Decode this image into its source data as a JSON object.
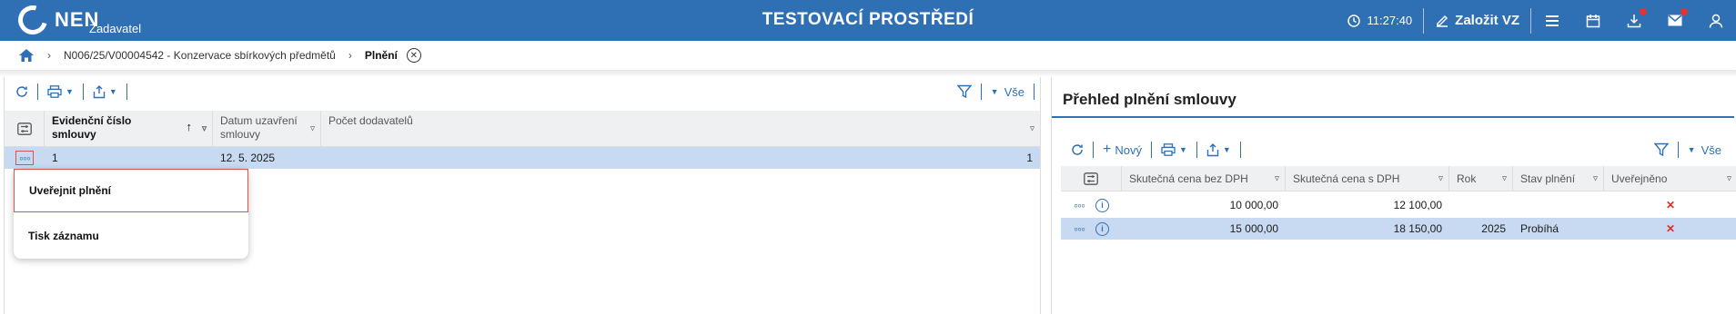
{
  "topbar": {
    "logo": "NEN",
    "role": "Zadavatel",
    "env_title": "TESTOVACÍ PROSTŘEDÍ",
    "time": "11:27:40",
    "create_label": "Založit VZ"
  },
  "breadcrumb": {
    "item1": "N006/25/V00004542 - Konzervace sbírkových předmětů",
    "current": "Plnění"
  },
  "left": {
    "filter_label": "Vše",
    "columns": [
      "Evidenční číslo smlouvy",
      "Datum uzavření smlouvy",
      "Počet dodavatelů"
    ],
    "rows": [
      {
        "c1": "1",
        "c2": "12. 5. 2025",
        "c3": "1"
      }
    ],
    "menu": [
      "Uveřejnit plnění",
      "Tisk záznamu"
    ]
  },
  "right": {
    "title": "Přehled plnění smlouvy",
    "new_label": "Nový",
    "filter_label": "Vše",
    "columns": [
      "Skutečná cena bez DPH",
      "Skutečná cena s DPH",
      "Rok",
      "Stav plnění",
      "Uveřejněno"
    ],
    "rows": [
      {
        "c1": "10 000,00",
        "c2": "12 100,00",
        "c3": "",
        "c4": "",
        "c5": "✕"
      },
      {
        "c1": "15 000,00",
        "c2": "18 150,00",
        "c3": "2025",
        "c4": "Probíhá",
        "c5": "✕"
      }
    ]
  }
}
